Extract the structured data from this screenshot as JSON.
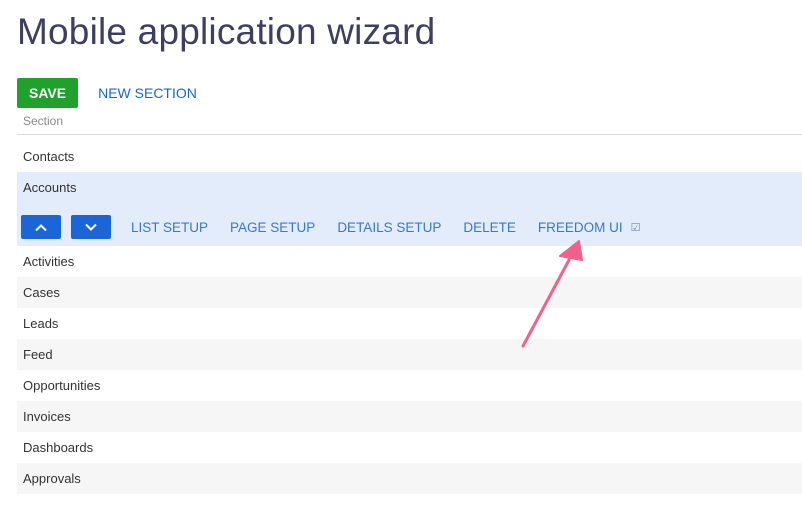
{
  "page": {
    "title": "Mobile application wizard"
  },
  "toolbar": {
    "save_label": "SAVE",
    "new_section_label": "NEW SECTION"
  },
  "table": {
    "column_header": "Section",
    "sections_before": [
      {
        "label": "Contacts"
      }
    ],
    "selected": {
      "label": "Accounts",
      "actions": {
        "list_setup": "LIST SETUP",
        "page_setup": "PAGE SETUP",
        "details_setup": "DETAILS SETUP",
        "delete": "DELETE",
        "freedom_ui": "FREEDOM UI"
      }
    },
    "sections_after": [
      {
        "label": "Activities"
      },
      {
        "label": "Cases"
      },
      {
        "label": "Leads"
      },
      {
        "label": "Feed"
      },
      {
        "label": "Opportunities"
      },
      {
        "label": "Invoices"
      },
      {
        "label": "Dashboards"
      },
      {
        "label": "Approvals"
      }
    ]
  },
  "icons": {
    "move_up": "chevron-up-icon",
    "move_down": "chevron-down-icon",
    "freedom_ui_checkbox": "checkbox-checked-icon"
  },
  "colors": {
    "save_button": "#1fa12c",
    "link": "#1a66c7",
    "selected_row": "#e3ecfb",
    "arrow_button": "#1a66d9",
    "annotation_arrow": "#f2618c"
  }
}
